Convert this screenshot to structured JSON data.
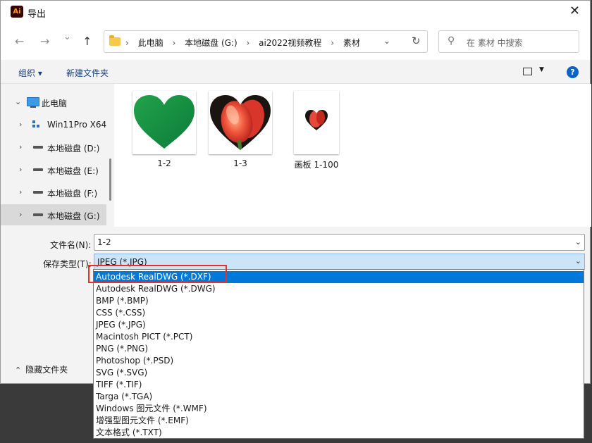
{
  "window": {
    "app_icon_text": "Ai",
    "title": "导出",
    "close_glyph": "✕"
  },
  "nav": {
    "back_glyph": "←",
    "forward_glyph": "→",
    "recent_glyph": "⌄",
    "up_glyph": "↑",
    "breadcrumbs": [
      "此电脑",
      "本地磁盘 (G:)",
      "ai2022视频教程",
      "素材"
    ],
    "separator": "›",
    "addr_dropdown_glyph": "⌄",
    "refresh_glyph": "↻",
    "search_placeholder": "在 素材 中搜索"
  },
  "toolbar": {
    "organize_label": "组织 ▾",
    "new_folder_label": "新建文件夹",
    "view_dropdown_glyph": "▼",
    "help_label": "?"
  },
  "navpane": {
    "items": [
      {
        "label": "此电脑",
        "chevron": "⌄",
        "icon": "computer-icon"
      },
      {
        "label": "Win11Pro X64",
        "chevron": "›",
        "icon": "network-icon"
      },
      {
        "label": "本地磁盘 (D:)",
        "chevron": "›",
        "icon": "drive-icon"
      },
      {
        "label": "本地磁盘 (E:)",
        "chevron": "›",
        "icon": "drive-icon"
      },
      {
        "label": "本地磁盘 (F:)",
        "chevron": "›",
        "icon": "drive-icon"
      },
      {
        "label": "本地磁盘 (G:)",
        "chevron": "›",
        "icon": "drive-icon",
        "selected": true
      }
    ]
  },
  "files": [
    {
      "name": "1-2",
      "thumb": "green-heart"
    },
    {
      "name": "1-3",
      "thumb": "tulip-heart"
    },
    {
      "name": "画板 1-100",
      "thumb": "small-tulip-heart"
    }
  ],
  "form": {
    "filename_label": "文件名(N):",
    "filename_value": "1-2",
    "filetype_label": "保存类型(T):",
    "filetype_value": "JPEG (*.JPG)",
    "dropdown_glyph": "⌄"
  },
  "filetype_options": [
    "Autodesk RealDWG (*.DXF)",
    "Autodesk RealDWG (*.DWG)",
    "BMP (*.BMP)",
    "CSS (*.CSS)",
    "JPEG (*.JPG)",
    "Macintosh PICT (*.PCT)",
    "PNG (*.PNG)",
    "Photoshop (*.PSD)",
    "SVG (*.SVG)",
    "TIFF (*.TIF)",
    "Targa (*.TGA)",
    "Windows 图元文件 (*.WMF)",
    "增强型图元文件 (*.EMF)",
    "文本格式 (*.TXT)"
  ],
  "highlighted_option_index": 0,
  "footer": {
    "hide_folders_chevron": "⌃",
    "hide_folders_label": "隐藏文件夹"
  },
  "colors": {
    "highlight": "#0078d7",
    "annotation_red": "#e3322b",
    "selected_field": "#cce4f7"
  }
}
